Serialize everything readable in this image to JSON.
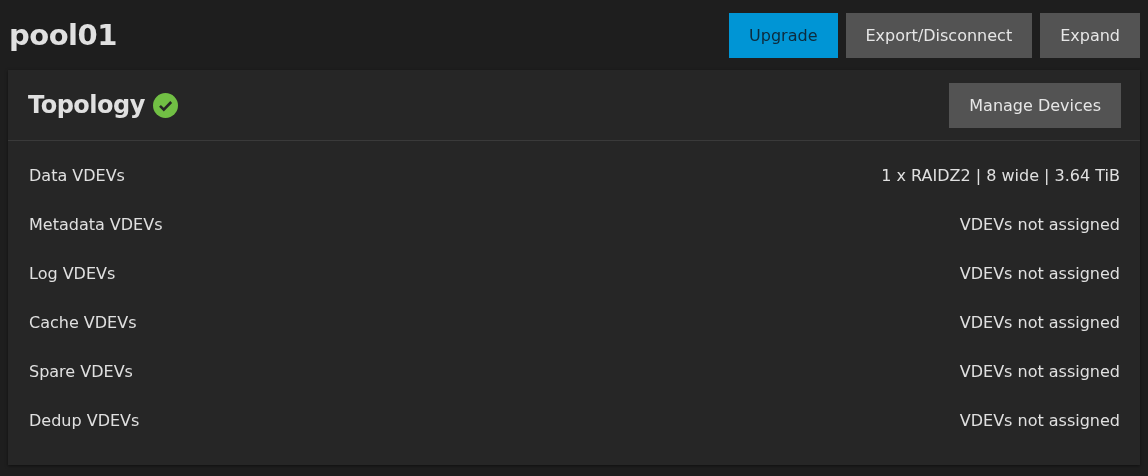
{
  "pool": {
    "title": "pool01"
  },
  "actions": [
    {
      "label": "Upgrade",
      "kind": "primary"
    },
    {
      "label": "Export/Disconnect",
      "kind": "default"
    },
    {
      "label": "Expand",
      "kind": "default"
    }
  ],
  "topology": {
    "title": "Topology",
    "healthy": true,
    "manage_button": "Manage Devices",
    "rows": [
      {
        "label": "Data VDEVs",
        "value": "1 x RAIDZ2 | 8 wide | 3.64 TiB"
      },
      {
        "label": "Metadata VDEVs",
        "value": "VDEVs not assigned"
      },
      {
        "label": "Log VDEVs",
        "value": "VDEVs not assigned"
      },
      {
        "label": "Cache VDEVs",
        "value": "VDEVs not assigned"
      },
      {
        "label": "Spare VDEVs",
        "value": "VDEVs not assigned"
      },
      {
        "label": "Dedup VDEVs",
        "value": "VDEVs not assigned"
      }
    ]
  }
}
